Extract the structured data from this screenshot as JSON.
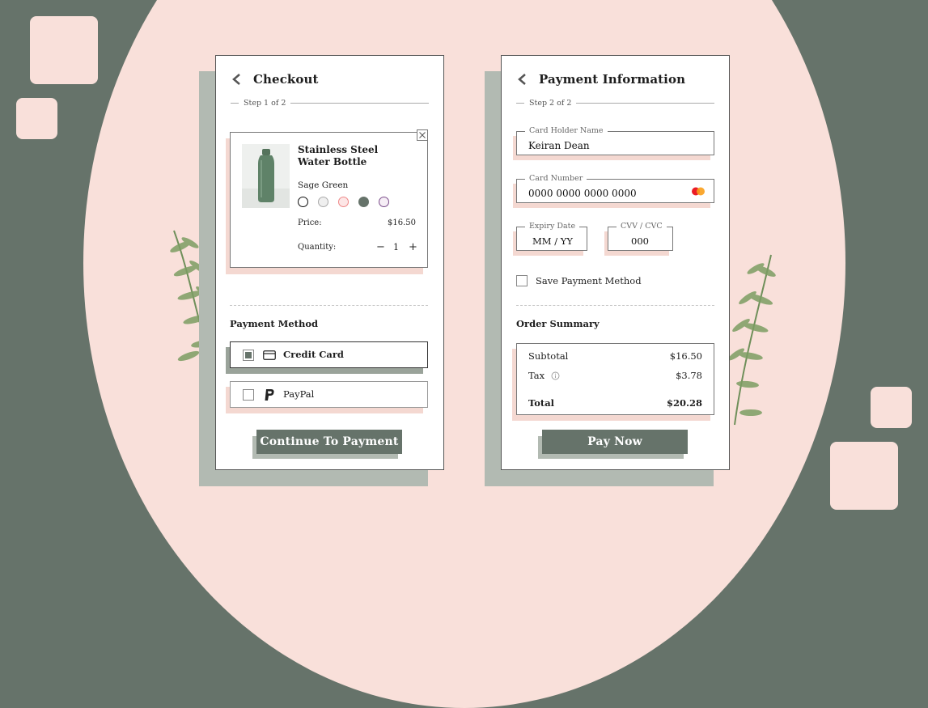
{
  "checkout": {
    "title": "Checkout",
    "step": "Step 1 of 2",
    "product": {
      "name": "Stainless Steel Water Bottle",
      "color_name": "Sage Green",
      "swatches": [
        "#ffffff",
        "#efefef",
        "#fde6e6",
        "#66736a",
        "#f6eef6"
      ],
      "price_label": "Price:",
      "price": "$16.50",
      "quantity_label": "Quantity:",
      "quantity": "1",
      "minus": "−",
      "plus": "+"
    },
    "payment_method_title": "Payment Method",
    "methods": [
      {
        "label": "Credit Card",
        "selected": true
      },
      {
        "label": "PayPal",
        "selected": false
      }
    ],
    "continue_label": "Continue To Payment"
  },
  "payment": {
    "title": "Payment Information",
    "step": "Step 2 of 2",
    "card_holder": {
      "label": "Card Holder Name",
      "value": "Keiran Dean"
    },
    "card_number": {
      "label": "Card Number",
      "value": "0000  0000  0000  0000"
    },
    "expiry": {
      "label": "Expiry Date",
      "value": "MM / YY"
    },
    "cvv": {
      "label": "CVV / CVC",
      "value": "000"
    },
    "save_label": "Save Payment Method",
    "summary_title": "Order Summary",
    "subtotal_label": "Subtotal",
    "subtotal": "$16.50",
    "tax_label": "Tax",
    "tax": "$3.78",
    "total_label": "Total",
    "total": "$20.28",
    "pay_label": "Pay Now"
  },
  "colors": {
    "sage": "#66736a",
    "blush": "#f9e0da",
    "shadow_grey": "#b2bab2",
    "pink_shadow": "#f4d8d1"
  }
}
